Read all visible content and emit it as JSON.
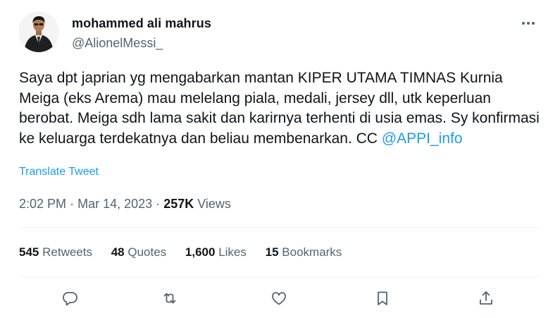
{
  "user": {
    "display_name": "mohammed ali mahrus",
    "handle": "@AlionelMessi_"
  },
  "tweet": {
    "text_before_mention": "Saya dpt japrian yg mengabarkan mantan KIPER UTAMA TIMNAS Kurnia Meiga (eks Arema) mau melelang piala, medali, jersey dll, utk keperluan berobat. Meiga sdh lama sakit dan karirnya terhenti di usia emas. Sy konfirmasi ke keluarga terdekatnya dan beliau membenarkan. CC ",
    "mention": "@APPI_info",
    "translate_label": "Translate Tweet"
  },
  "meta": {
    "time": "2:02 PM",
    "separator": "·",
    "date": "Mar 14, 2023",
    "views_count": "257K",
    "views_label": "Views"
  },
  "stats": {
    "retweets_count": "545",
    "retweets_label": "Retweets",
    "quotes_count": "48",
    "quotes_label": "Quotes",
    "likes_count": "1,600",
    "likes_label": "Likes",
    "bookmarks_count": "15",
    "bookmarks_label": "Bookmarks"
  },
  "icons": {
    "more": "more-icon",
    "reply": "reply-icon",
    "retweet": "retweet-icon",
    "like": "heart-icon",
    "bookmark": "bookmark-icon",
    "share": "share-icon"
  },
  "colors": {
    "link": "#1d9bf0",
    "secondary_text": "#536471",
    "primary_text": "#0f1419",
    "divider": "#eff3f4"
  }
}
